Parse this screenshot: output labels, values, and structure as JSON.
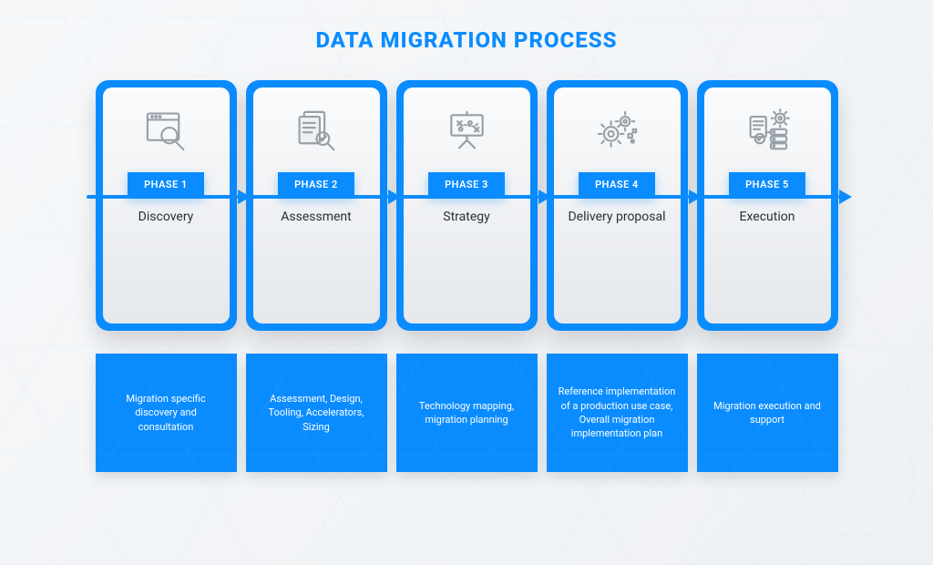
{
  "title": "DATA MIGRATION PROCESS",
  "phases": [
    {
      "badge": "PHASE 1",
      "name": "Discovery",
      "icon": "browser-magnify-icon",
      "desc": "Migration specific discovery and consultation"
    },
    {
      "badge": "PHASE 2",
      "name": "Assessment",
      "icon": "document-check-icon",
      "desc": "Assessment, Design, Tooling, Accelerators, Sizing"
    },
    {
      "badge": "PHASE 3",
      "name": "Strategy",
      "icon": "strategy-board-icon",
      "desc": "Technology mapping, migration planning"
    },
    {
      "badge": "PHASE 4",
      "name": "Delivery proposal",
      "icon": "gears-icon",
      "desc": "Reference implementation of a production use case, Overall migration implementation plan"
    },
    {
      "badge": "PHASE 5",
      "name": "Execution",
      "icon": "execution-stack-icon",
      "desc": "Migration execution and support"
    }
  ],
  "colors": {
    "accent": "#0a8cff",
    "icon": "#97a0a8",
    "text": "#2a2f35"
  }
}
